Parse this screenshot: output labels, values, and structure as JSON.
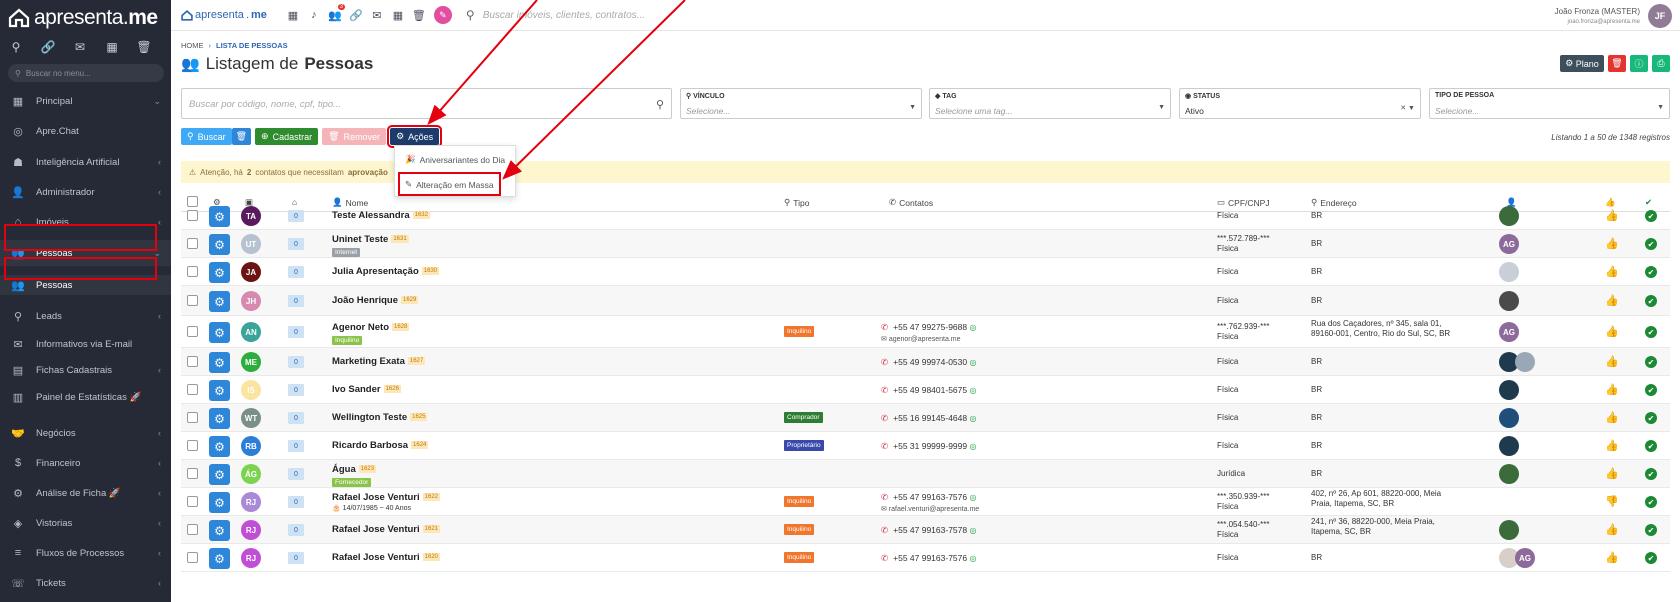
{
  "sidebar": {
    "logo": {
      "pre": "apresenta",
      "dot": ".",
      "post": "me"
    },
    "search_placeholder": "Buscar no menu...",
    "items": [
      {
        "label": "Principal",
        "icon": "dashboard-icon",
        "chevron": "⌄"
      },
      {
        "label": "Apre.Chat",
        "icon": "whatsapp-icon",
        "chevron": ""
      },
      {
        "label": "Inteligência Artificial",
        "icon": "robot-icon",
        "chevron": "‹"
      },
      {
        "label": "Administrador",
        "icon": "user-icon",
        "chevron": "‹"
      },
      {
        "label": "Imóveis",
        "icon": "home-icon",
        "chevron": "‹"
      },
      {
        "label": "Pessoas",
        "icon": "people-icon",
        "chevron": "⌄"
      },
      {
        "label": "Pessoas",
        "icon": "people-icon",
        "chevron": ""
      },
      {
        "label": "Leads",
        "icon": "leads-icon",
        "chevron": "‹"
      },
      {
        "label": "Informativos via E-mail",
        "icon": "email-icon",
        "chevron": ""
      },
      {
        "label": "Fichas Cadastrais",
        "icon": "folder-icon",
        "chevron": "‹"
      },
      {
        "label": "Painel de Estatísticas 🚀",
        "icon": "chart-icon",
        "chevron": ""
      },
      {
        "label": "Negócios",
        "icon": "handshake-icon",
        "chevron": "‹"
      },
      {
        "label": "Financeiro",
        "icon": "dollar-icon",
        "chevron": "‹"
      },
      {
        "label": "Análise de Ficha 🚀",
        "icon": "analysis-icon",
        "chevron": "‹"
      },
      {
        "label": "Vistorias",
        "icon": "inspection-icon",
        "chevron": "‹"
      },
      {
        "label": "Fluxos de Processos",
        "icon": "flow-icon",
        "chevron": "‹"
      },
      {
        "label": "Tickets",
        "icon": "ticket-icon",
        "chevron": "‹"
      }
    ]
  },
  "topbar": {
    "logo_pre": "apresenta",
    "logo_post": "me",
    "badge": "3",
    "search_placeholder": "Buscar imóveis, clientes, contratos...",
    "user_name": "João Fronza (MASTER)",
    "user_email": "joao.fronza@apresenta.me",
    "user_initials": "JF"
  },
  "breadcrumb": {
    "home": "HOME",
    "current": "LISTA DE PESSOAS"
  },
  "page_title": {
    "pre": "Listagem de",
    "bold": "Pessoas"
  },
  "header_buttons": {
    "plano": "Plano"
  },
  "search": {
    "placeholder": "Buscar por código, nome, cpf, tipo..."
  },
  "filters": [
    {
      "label": "VÍNCULO",
      "value": "Selecione...",
      "placeholder": true
    },
    {
      "label": "TAG",
      "value": "Selecione uma tag...",
      "placeholder": true
    },
    {
      "label": "STATUS",
      "value": "Ativo",
      "placeholder": false
    },
    {
      "label": "TIPO DE PESSOA",
      "value": "Selecione...",
      "placeholder": true
    }
  ],
  "actions": {
    "buscar": "Buscar",
    "cadastrar": "Cadastrar",
    "remover": "Remover",
    "acoes": "Ações"
  },
  "listing": "Listando 1 a 50 de 1348 registros",
  "alert": {
    "pre": "Atenção, há",
    "count": "2",
    "mid": "contatos que necessitam",
    "bold": "aprovação"
  },
  "dropdown": {
    "item1": "Aniversariantes do Dia",
    "item2": "Alteração em Massa"
  },
  "columns": {
    "nome": "Nome",
    "tipo": "Tipo",
    "contatos": "Contatos",
    "cpf": "CPF/CNPJ",
    "endereco": "Endereço"
  },
  "rows": [
    {
      "initials": "TA",
      "avatar_color": "#5a1a5e",
      "count": "0",
      "name": "Teste Alessandra",
      "code": "1632",
      "sub": "",
      "sub_color": "",
      "tipo": "",
      "tipo_color": "",
      "phone": "",
      "email": "",
      "cpf": "",
      "pessoa": "Física",
      "endereco": "BR",
      "resp": [
        {
          "t": "",
          "c": "#3b6b3a"
        }
      ],
      "thumb": "up"
    },
    {
      "initials": "UT",
      "avatar_color": "#b6c2cf",
      "count": "0",
      "name": "Uninet Teste",
      "code": "1631",
      "sub": "Internet",
      "sub_color": "#9aa0a6",
      "tipo": "",
      "tipo_color": "",
      "phone": "",
      "email": "",
      "cpf": "***.572.789-***",
      "pessoa": "Física",
      "endereco": "BR",
      "resp": [
        {
          "t": "AG",
          "c": "#8c6a9a"
        }
      ],
      "thumb": "up"
    },
    {
      "initials": "JA",
      "avatar_color": "#6b1414",
      "count": "0",
      "name": "Julia Apresentação",
      "code": "1630",
      "sub": "",
      "sub_color": "",
      "tipo": "",
      "tipo_color": "",
      "phone": "",
      "email": "",
      "cpf": "",
      "pessoa": "Física",
      "endereco": "BR",
      "resp": [
        {
          "t": "",
          "c": "#c9cfd6"
        }
      ],
      "thumb": "up"
    },
    {
      "initials": "JH",
      "avatar_color": "#d68ab0",
      "count": "0",
      "name": "João Henrique",
      "code": "1629",
      "sub": "",
      "sub_color": "",
      "tipo": "",
      "tipo_color": "",
      "phone": "",
      "email": "",
      "cpf": "",
      "pessoa": "Física",
      "endereco": "BR",
      "resp": [
        {
          "t": "",
          "c": "#4a4a4a"
        }
      ],
      "thumb": "up"
    },
    {
      "initials": "AN",
      "avatar_color": "#3aa39a",
      "count": "0",
      "name": "Agenor Neto",
      "code": "1628",
      "sub": "Inquilino",
      "sub_color": "#8bc34a",
      "tipo": "Inquilino",
      "tipo_color": "#f0752d",
      "phone": "+55 47 99275-9688",
      "email": "agenor@apresenta.me",
      "cpf": "***.762.939-***",
      "pessoa": "Física",
      "endereco": "Rua dos Caçadores, nº 345, sala 01, 89160-001, Centro, Rio do Sul, SC, BR",
      "resp": [
        {
          "t": "AG",
          "c": "#8c6a9a"
        }
      ],
      "thumb": "up"
    },
    {
      "initials": "ME",
      "avatar_color": "#2cae3f",
      "count": "0",
      "name": "Marketing Exata",
      "code": "1627",
      "sub": "",
      "sub_color": "",
      "tipo": "",
      "tipo_color": "",
      "phone": "+55 49 99974-0530",
      "email": "",
      "cpf": "",
      "pessoa": "Física",
      "endereco": "BR",
      "resp": [
        {
          "t": "",
          "c": "#1f3a4d"
        },
        {
          "t": "",
          "c": "#9aa7b5"
        }
      ],
      "thumb": "up"
    },
    {
      "initials": "IS",
      "avatar_color": "#fbe3a0",
      "count": "0",
      "name": "Ivo Sander",
      "code": "1626",
      "sub": "",
      "sub_color": "",
      "tipo": "",
      "tipo_color": "",
      "phone": "+55 49 98401-5675",
      "email": "",
      "cpf": "",
      "pessoa": "Física",
      "endereco": "BR",
      "resp": [
        {
          "t": "",
          "c": "#1f3a4d"
        }
      ],
      "thumb": "up"
    },
    {
      "initials": "WT",
      "avatar_color": "#7a8f8a",
      "count": "0",
      "name": "Wellington Teste",
      "code": "1625",
      "sub": "",
      "sub_color": "",
      "tipo": "Comprador",
      "tipo_color": "#2e7d32",
      "phone": "+55 16 99145-4648",
      "email": "",
      "cpf": "",
      "pessoa": "Física",
      "endereco": "BR",
      "resp": [
        {
          "t": "",
          "c": "#1e4f7a"
        }
      ],
      "thumb": "up"
    },
    {
      "initials": "RB",
      "avatar_color": "#2b7fd9",
      "count": "0",
      "name": "Ricardo Barbosa",
      "code": "1624",
      "sub": "",
      "sub_color": "",
      "tipo": "Proprietário",
      "tipo_color": "#3949ab",
      "phone": "+55 31 99999-9999",
      "email": "",
      "cpf": "",
      "pessoa": "Física",
      "endereco": "BR",
      "resp": [
        {
          "t": "",
          "c": "#1f3a4d"
        }
      ],
      "thumb": "up"
    },
    {
      "initials": "ÁG",
      "avatar_color": "#7bd34e",
      "count": "0",
      "name": "Água",
      "code": "1623",
      "sub": "Fornecedor",
      "sub_color": "#8bc34a",
      "tipo": "",
      "tipo_color": "",
      "phone": "",
      "email": "",
      "cpf": "",
      "pessoa": "Jurídica",
      "endereco": "BR",
      "resp": [
        {
          "t": "",
          "c": "#3b6b3a"
        }
      ],
      "thumb": "up"
    },
    {
      "initials": "RJ",
      "avatar_color": "#a98ad6",
      "count": "0",
      "name": "Rafael Jose Venturi",
      "code": "1622",
      "sub": "14/07/1985 ~ 40 Anos",
      "sub_color": "",
      "tipo": "Inquilino",
      "tipo_color": "#f0752d",
      "phone": "+55 47 99163-7576",
      "email": "rafael.venturi@apresenta.me",
      "cpf": "***.350.939-***",
      "pessoa": "Física",
      "endereco": "402, nº 26, Ap 601, 88220-000, Meia Praia, Itapema, SC, BR",
      "resp": [],
      "thumb": "down"
    },
    {
      "initials": "RJ",
      "avatar_color": "#c04fd6",
      "count": "0",
      "name": "Rafael Jose Venturi",
      "code": "1621",
      "sub": "",
      "sub_color": "",
      "tipo": "Inquilino",
      "tipo_color": "#f0752d",
      "phone": "+55 47 99163-7578",
      "email": "",
      "cpf": "***.054.540-***",
      "pessoa": "Física",
      "endereco": "241, nº 36, 88220-000, Meia Praia, Itapema, SC, BR",
      "resp": [
        {
          "t": "",
          "c": "#3b6b3a"
        }
      ],
      "thumb": "up"
    },
    {
      "initials": "RJ",
      "avatar_color": "#c04fd6",
      "count": "0",
      "name": "Rafael Jose Venturi",
      "code": "1620",
      "sub": "",
      "sub_color": "",
      "tipo": "Inquilino",
      "tipo_color": "#f0752d",
      "phone": "+55 47 99163-7576",
      "email": "",
      "cpf": "",
      "pessoa": "Física",
      "endereco": "BR",
      "resp": [
        {
          "t": "",
          "c": "#d8d0c8"
        },
        {
          "t": "AG",
          "c": "#8c6a9a"
        }
      ],
      "thumb": "up"
    }
  ]
}
